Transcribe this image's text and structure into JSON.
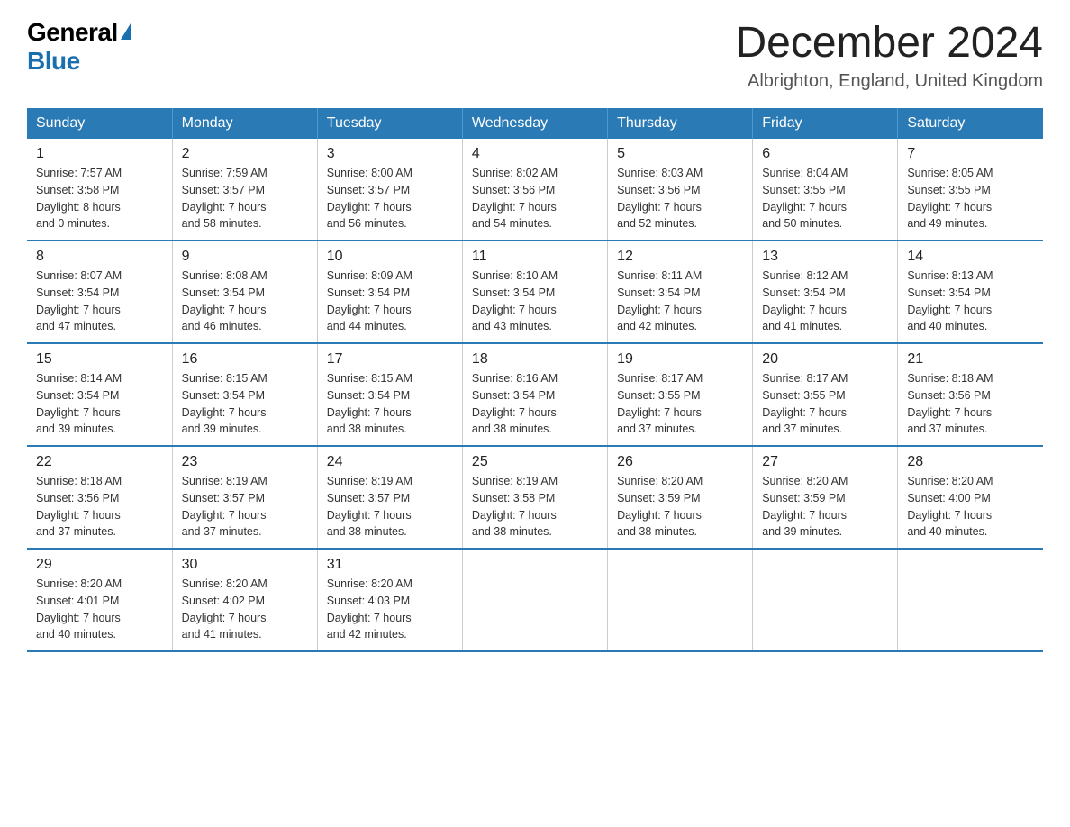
{
  "logo": {
    "general": "General",
    "blue": "Blue",
    "triangle": "▶"
  },
  "title": "December 2024",
  "location": "Albrighton, England, United Kingdom",
  "days_of_week": [
    "Sunday",
    "Monday",
    "Tuesday",
    "Wednesday",
    "Thursday",
    "Friday",
    "Saturday"
  ],
  "weeks": [
    [
      {
        "day": "1",
        "sunrise": "7:57 AM",
        "sunset": "3:58 PM",
        "daylight": "8 hours and 0 minutes."
      },
      {
        "day": "2",
        "sunrise": "7:59 AM",
        "sunset": "3:57 PM",
        "daylight": "7 hours and 58 minutes."
      },
      {
        "day": "3",
        "sunrise": "8:00 AM",
        "sunset": "3:57 PM",
        "daylight": "7 hours and 56 minutes."
      },
      {
        "day": "4",
        "sunrise": "8:02 AM",
        "sunset": "3:56 PM",
        "daylight": "7 hours and 54 minutes."
      },
      {
        "day": "5",
        "sunrise": "8:03 AM",
        "sunset": "3:56 PM",
        "daylight": "7 hours and 52 minutes."
      },
      {
        "day": "6",
        "sunrise": "8:04 AM",
        "sunset": "3:55 PM",
        "daylight": "7 hours and 50 minutes."
      },
      {
        "day": "7",
        "sunrise": "8:05 AM",
        "sunset": "3:55 PM",
        "daylight": "7 hours and 49 minutes."
      }
    ],
    [
      {
        "day": "8",
        "sunrise": "8:07 AM",
        "sunset": "3:54 PM",
        "daylight": "7 hours and 47 minutes."
      },
      {
        "day": "9",
        "sunrise": "8:08 AM",
        "sunset": "3:54 PM",
        "daylight": "7 hours and 46 minutes."
      },
      {
        "day": "10",
        "sunrise": "8:09 AM",
        "sunset": "3:54 PM",
        "daylight": "7 hours and 44 minutes."
      },
      {
        "day": "11",
        "sunrise": "8:10 AM",
        "sunset": "3:54 PM",
        "daylight": "7 hours and 43 minutes."
      },
      {
        "day": "12",
        "sunrise": "8:11 AM",
        "sunset": "3:54 PM",
        "daylight": "7 hours and 42 minutes."
      },
      {
        "day": "13",
        "sunrise": "8:12 AM",
        "sunset": "3:54 PM",
        "daylight": "7 hours and 41 minutes."
      },
      {
        "day": "14",
        "sunrise": "8:13 AM",
        "sunset": "3:54 PM",
        "daylight": "7 hours and 40 minutes."
      }
    ],
    [
      {
        "day": "15",
        "sunrise": "8:14 AM",
        "sunset": "3:54 PM",
        "daylight": "7 hours and 39 minutes."
      },
      {
        "day": "16",
        "sunrise": "8:15 AM",
        "sunset": "3:54 PM",
        "daylight": "7 hours and 39 minutes."
      },
      {
        "day": "17",
        "sunrise": "8:15 AM",
        "sunset": "3:54 PM",
        "daylight": "7 hours and 38 minutes."
      },
      {
        "day": "18",
        "sunrise": "8:16 AM",
        "sunset": "3:54 PM",
        "daylight": "7 hours and 38 minutes."
      },
      {
        "day": "19",
        "sunrise": "8:17 AM",
        "sunset": "3:55 PM",
        "daylight": "7 hours and 37 minutes."
      },
      {
        "day": "20",
        "sunrise": "8:17 AM",
        "sunset": "3:55 PM",
        "daylight": "7 hours and 37 minutes."
      },
      {
        "day": "21",
        "sunrise": "8:18 AM",
        "sunset": "3:56 PM",
        "daylight": "7 hours and 37 minutes."
      }
    ],
    [
      {
        "day": "22",
        "sunrise": "8:18 AM",
        "sunset": "3:56 PM",
        "daylight": "7 hours and 37 minutes."
      },
      {
        "day": "23",
        "sunrise": "8:19 AM",
        "sunset": "3:57 PM",
        "daylight": "7 hours and 37 minutes."
      },
      {
        "day": "24",
        "sunrise": "8:19 AM",
        "sunset": "3:57 PM",
        "daylight": "7 hours and 38 minutes."
      },
      {
        "day": "25",
        "sunrise": "8:19 AM",
        "sunset": "3:58 PM",
        "daylight": "7 hours and 38 minutes."
      },
      {
        "day": "26",
        "sunrise": "8:20 AM",
        "sunset": "3:59 PM",
        "daylight": "7 hours and 38 minutes."
      },
      {
        "day": "27",
        "sunrise": "8:20 AM",
        "sunset": "3:59 PM",
        "daylight": "7 hours and 39 minutes."
      },
      {
        "day": "28",
        "sunrise": "8:20 AM",
        "sunset": "4:00 PM",
        "daylight": "7 hours and 40 minutes."
      }
    ],
    [
      {
        "day": "29",
        "sunrise": "8:20 AM",
        "sunset": "4:01 PM",
        "daylight": "7 hours and 40 minutes."
      },
      {
        "day": "30",
        "sunrise": "8:20 AM",
        "sunset": "4:02 PM",
        "daylight": "7 hours and 41 minutes."
      },
      {
        "day": "31",
        "sunrise": "8:20 AM",
        "sunset": "4:03 PM",
        "daylight": "7 hours and 42 minutes."
      },
      null,
      null,
      null,
      null
    ]
  ],
  "labels": {
    "sunrise": "Sunrise:",
    "sunset": "Sunset:",
    "daylight": "Daylight:"
  }
}
